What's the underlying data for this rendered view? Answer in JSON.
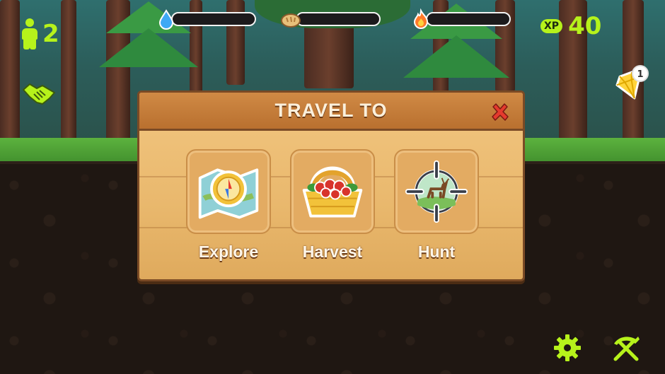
{
  "hud": {
    "population": "2",
    "xp_badge": "XP",
    "xp_value": "40",
    "gem_count": "1",
    "bars": [
      {
        "name": "water-bar",
        "icon": "water-drop-icon",
        "fill": 0.0,
        "color": "#3fa9f5"
      },
      {
        "name": "food-bar",
        "icon": "bread-icon",
        "fill": 0.0,
        "color": "#e8c07a"
      },
      {
        "name": "fire-bar",
        "icon": "fire-icon",
        "fill": 0.0,
        "color": "#ff7a2a"
      }
    ]
  },
  "travel_panel": {
    "title": "TRAVEL TO",
    "close_icon": "close-x-icon",
    "options": [
      {
        "label": "Explore",
        "icon": "compass-map-icon"
      },
      {
        "label": "Harvest",
        "icon": "berry-basket-icon"
      },
      {
        "label": "Hunt",
        "icon": "crosshair-deer-icon"
      }
    ]
  },
  "colors": {
    "hud_green": "#b6f21b",
    "panel_wood": "#e9b86d",
    "panel_header": "#c07a37",
    "close_red": "#e53a2e"
  }
}
